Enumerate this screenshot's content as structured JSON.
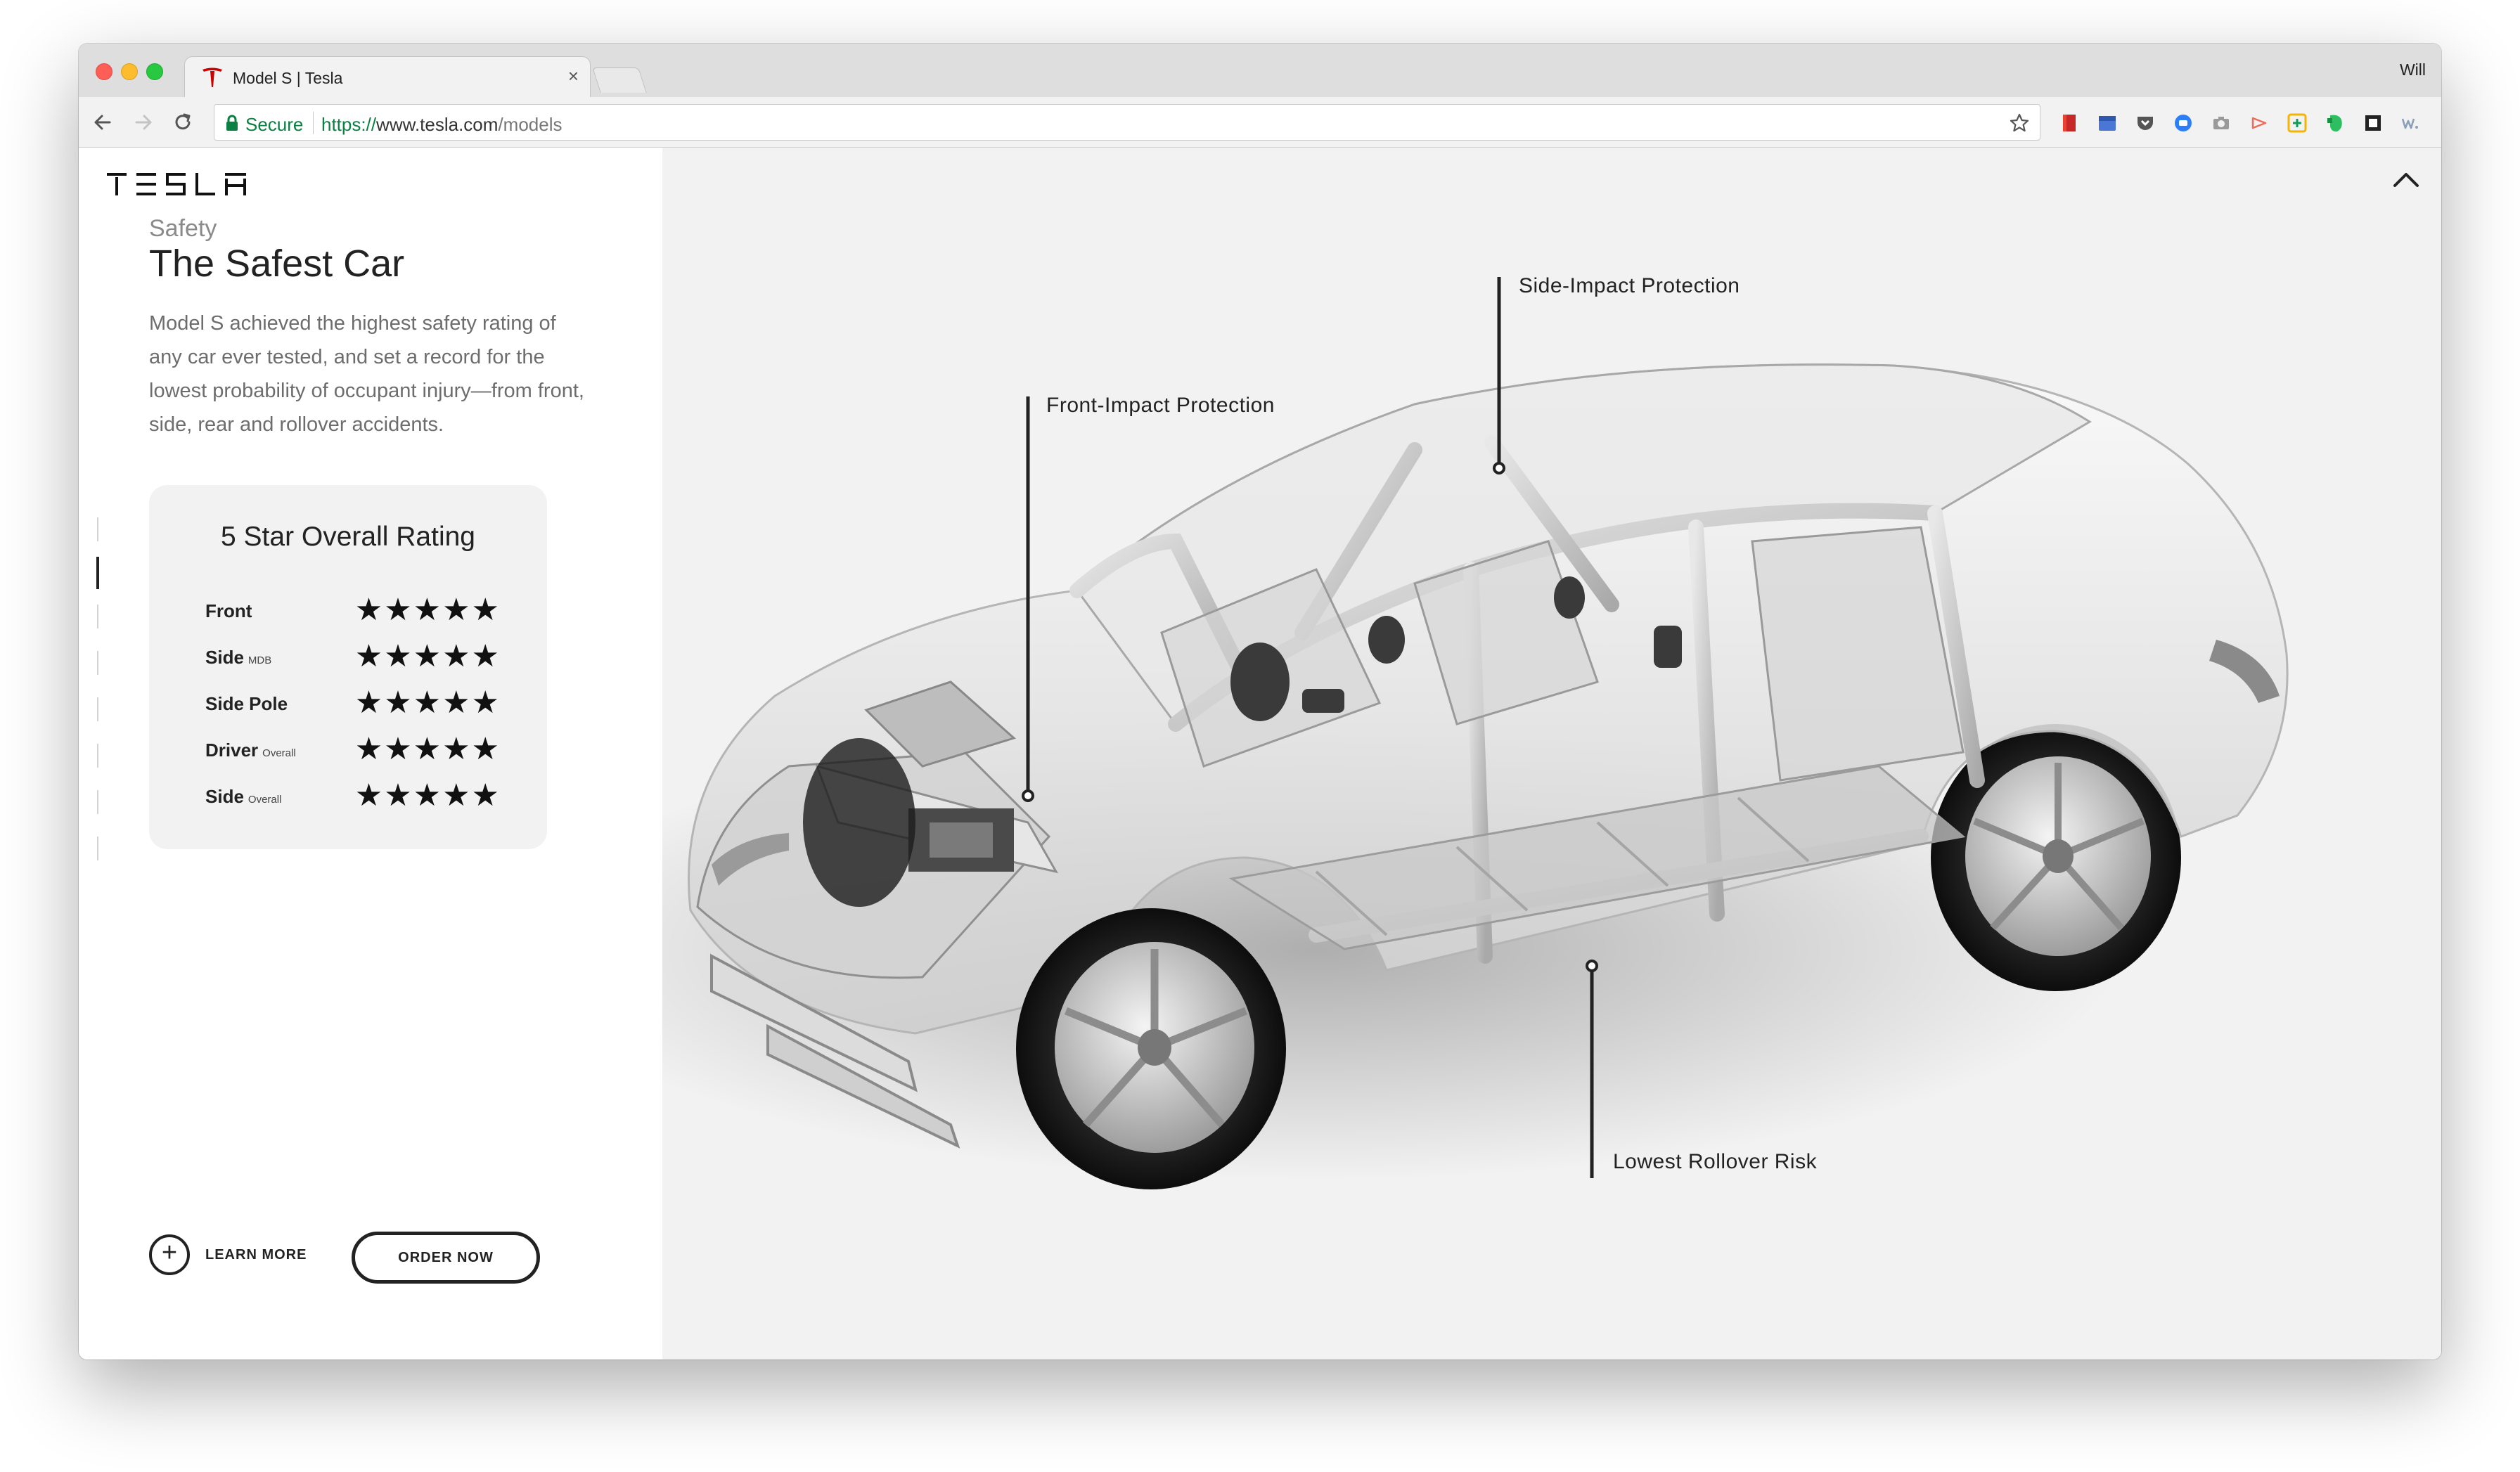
{
  "window": {
    "tab_title": "Model S | Tesla",
    "tab_close": "×",
    "profile_name": "Will"
  },
  "toolbar": {
    "secure_label": "Secure",
    "url_protocol": "https://",
    "url_host": "www.tesla.com",
    "url_path": "/models",
    "extensions": [
      "bookmark-extension-icon",
      "calendar-extension-icon",
      "pocket-icon",
      "screencast-icon",
      "camera-icon",
      "video-icon",
      "google-plus-icon",
      "evernote-icon",
      "reader-icon",
      "wordweb-icon",
      "translate-icon",
      "menu-icon"
    ]
  },
  "brand": {
    "logo_text": "TESLA",
    "accent_color": "#cc0000"
  },
  "intro": {
    "eyebrow": "Safety",
    "title": "The Safest Car",
    "description": "Model S achieved the highest safety rating of any car ever tested, and set a record for the lowest probability of occupant injury—from front, side, rear and rollover accidents."
  },
  "rating": {
    "title": "5 Star Overall Rating",
    "rows": [
      {
        "label": "Front",
        "sub": "",
        "stars": 5,
        "stars_text": "★★★★★"
      },
      {
        "label": "Side",
        "sub": "MDB",
        "stars": 5,
        "stars_text": "★★★★★"
      },
      {
        "label": "Side Pole",
        "sub": "",
        "stars": 5,
        "stars_text": "★★★★★"
      },
      {
        "label": "Driver",
        "sub": "Overall",
        "stars": 5,
        "stars_text": "★★★★★"
      },
      {
        "label": "Side",
        "sub": "Overall",
        "stars": 5,
        "stars_text": "★★★★★"
      }
    ]
  },
  "actions": {
    "learn_more_symbol": "+",
    "learn_more_label": "LEARN MORE",
    "order_now_label": "ORDER NOW"
  },
  "callouts": {
    "side_impact": "Side-Impact Protection",
    "front_impact": "Front-Impact Protection",
    "rollover": "Lowest Rollover Risk"
  },
  "colors": {
    "page_background": "#f2f2f2",
    "secure_green": "#0b8043",
    "text_dark": "#222222"
  }
}
